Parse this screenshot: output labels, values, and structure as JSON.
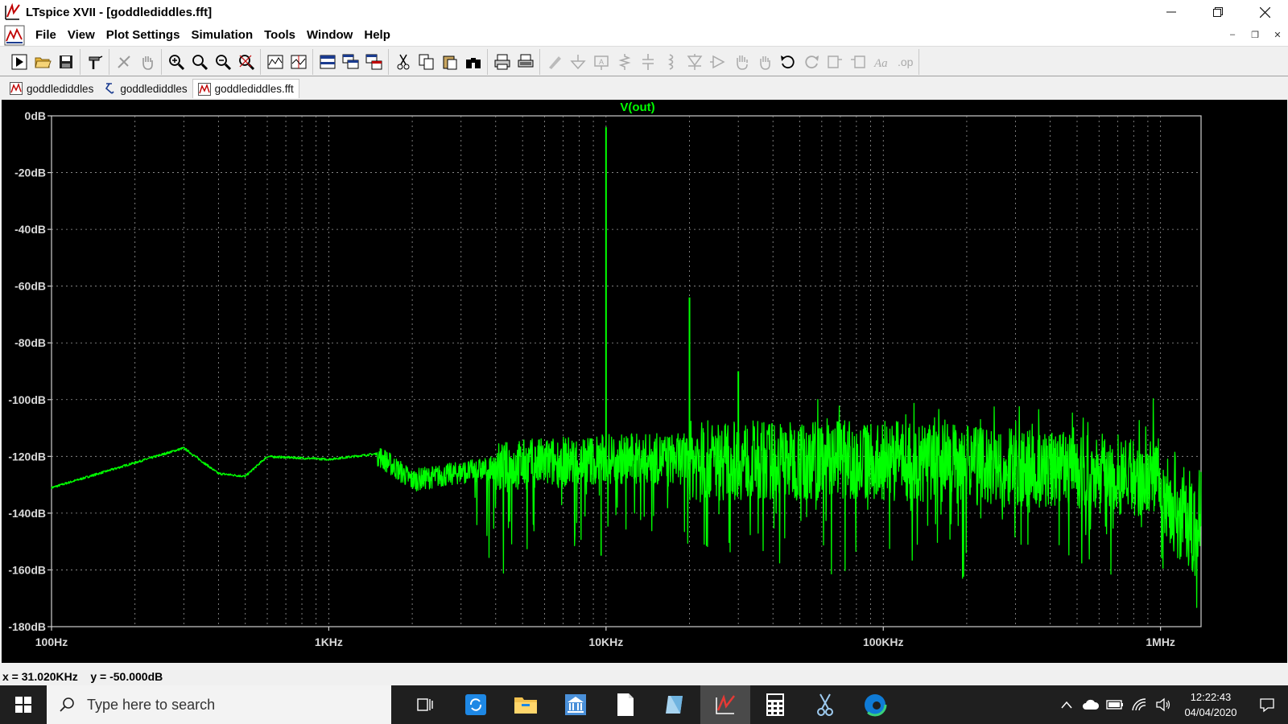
{
  "window": {
    "title": "LTspice XVII - [goddlediddles.fft]",
    "controls": [
      "minimize",
      "restore",
      "close"
    ]
  },
  "menu": {
    "items": [
      "File",
      "View",
      "Plot Settings",
      "Simulation",
      "Tools",
      "Window",
      "Help"
    ]
  },
  "tabs": [
    {
      "label": "goddlediddles",
      "icon": "waveform-icon"
    },
    {
      "label": "goddlediddles",
      "icon": "schematic-icon"
    },
    {
      "label": "goddlediddles.fft",
      "icon": "waveform-icon",
      "active": true
    }
  ],
  "colors": {
    "plot_bg": "#000000",
    "trace": "#00ff00",
    "grid": "#9a9a9a",
    "axis_label": "#d9d9d9",
    "title_text": "#00ff00"
  },
  "status": {
    "readout": "x = 31.020KHz    y = -50.000dB"
  },
  "taskbar": {
    "search_placeholder": "Type here to search",
    "time": "12:22:43",
    "date": "04/04/2020"
  },
  "chart_data": {
    "type": "line",
    "title": "V(out)",
    "x_scale": "log",
    "xlim": [
      100,
      1400000
    ],
    "ylim": [
      -180,
      0
    ],
    "x_ticks": [
      100,
      1000,
      10000,
      100000,
      1000000
    ],
    "x_tick_labels": [
      "100Hz",
      "1KHz",
      "10KHz",
      "100KHz",
      "1MHz"
    ],
    "y_ticks": [
      0,
      -20,
      -40,
      -60,
      -80,
      -100,
      -120,
      -140,
      -160,
      -180
    ],
    "y_tick_labels": [
      "0dB",
      "-20dB",
      "-40dB",
      "-60dB",
      "-80dB",
      "-100dB",
      "-120dB",
      "-140dB",
      "-160dB",
      "-180dB"
    ],
    "grid": true,
    "series": [
      {
        "name": "V(out)",
        "peaks": [
          {
            "x": 10000,
            "y": -4
          },
          {
            "x": 20000,
            "y": -64
          },
          {
            "x": 30000,
            "y": -90
          }
        ],
        "noise_floor_envelope": [
          {
            "x": 100,
            "y": -131
          },
          {
            "x": 300,
            "y": -117
          },
          {
            "x": 400,
            "y": -126
          },
          {
            "x": 500,
            "y": -127
          },
          {
            "x": 600,
            "y": -120
          },
          {
            "x": 1000,
            "y": -121
          },
          {
            "x": 1500,
            "y": -119
          },
          {
            "x": 2000,
            "y": -128
          },
          {
            "x": 5000,
            "y": -122
          },
          {
            "x": 10000,
            "y": -120
          },
          {
            "x": 100000,
            "y": -120
          },
          {
            "x": 1000000,
            "y": -126
          },
          {
            "x": 1400000,
            "y": -133
          }
        ]
      }
    ]
  }
}
